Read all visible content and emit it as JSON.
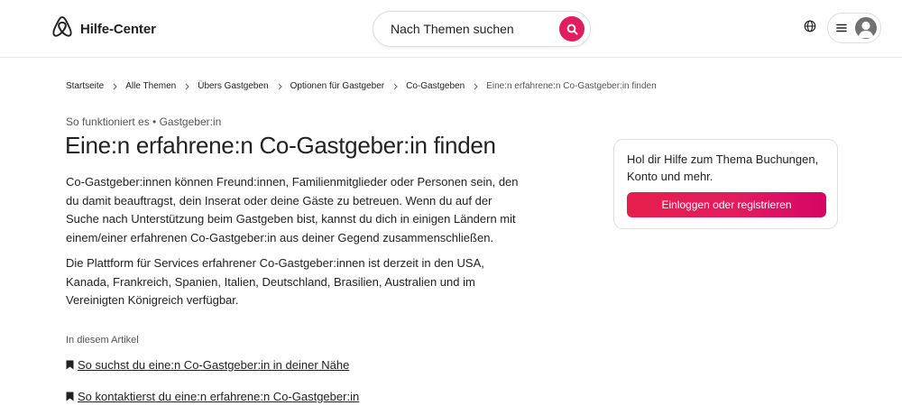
{
  "header": {
    "brand": "Hilfe-Center",
    "search": {
      "label": "Nach Themen suchen"
    },
    "accent": "#e31c5f",
    "icons": [
      "airbnb-logo-icon",
      "search-icon",
      "globe-icon",
      "menu-icon",
      "user-avatar-icon"
    ]
  },
  "breadcrumb": {
    "items": [
      "Startseite",
      "Alle Themen",
      "Übers Gastgeben",
      "Optionen für Gastgeber",
      "Co-Gastgeben",
      "Eine:n erfahrene:n Co-Gastgeber:in finden"
    ]
  },
  "article": {
    "eyebrow": "So funktioniert es • Gastgeber:in",
    "title": "Eine:n erfahrene:n Co-Gastgeber:in finden",
    "paragraphs": [
      "Co-Gastgeber:innen können Freund:innen, Familienmitglieder oder Personen sein, den du damit beauftragst, dein Inserat oder deine Gäste zu betreuen. Wenn du auf der Suche nach Unterstützung beim Gastgeben bist, kannst du dich in einigen Ländern mit einem/einer erfahrenen Co-Gastgeber:in aus deiner Gegend zusammenschließen.",
      "Die Plattform für Services erfahrener Co-Gastgeber:innen ist derzeit in den USA, Kanada, Frankreich, Spanien, Italien, Deutschland, Brasilien, Australien und im Vereinigten Königreich verfügbar."
    ],
    "toc": {
      "label": "In diesem Artikel",
      "items": [
        "So suchst du eine:n Co-Gastgeber:in in deiner Nähe",
        "So kontaktierst du eine:n erfahrene:n Co-Gastgeber:in"
      ]
    }
  },
  "help_card": {
    "text": "Hol dir Hilfe zum Thema Buchungen, Konto und mehr.",
    "button": "Einloggen oder registrieren"
  }
}
